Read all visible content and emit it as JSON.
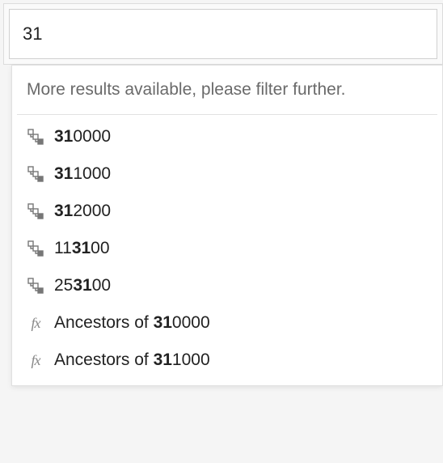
{
  "search": {
    "value": "31",
    "query": "31"
  },
  "dropdown": {
    "info": "More results available, please filter further.",
    "items": [
      {
        "type": "hierarchy",
        "value": "310000"
      },
      {
        "type": "hierarchy",
        "value": "311000"
      },
      {
        "type": "hierarchy",
        "value": "312000"
      },
      {
        "type": "hierarchy",
        "value": "113100"
      },
      {
        "type": "hierarchy",
        "value": "253100"
      },
      {
        "type": "fx",
        "prefix": "Ancestors of ",
        "value": "310000"
      },
      {
        "type": "fx",
        "prefix": "Ancestors of ",
        "value": "311000"
      }
    ]
  }
}
